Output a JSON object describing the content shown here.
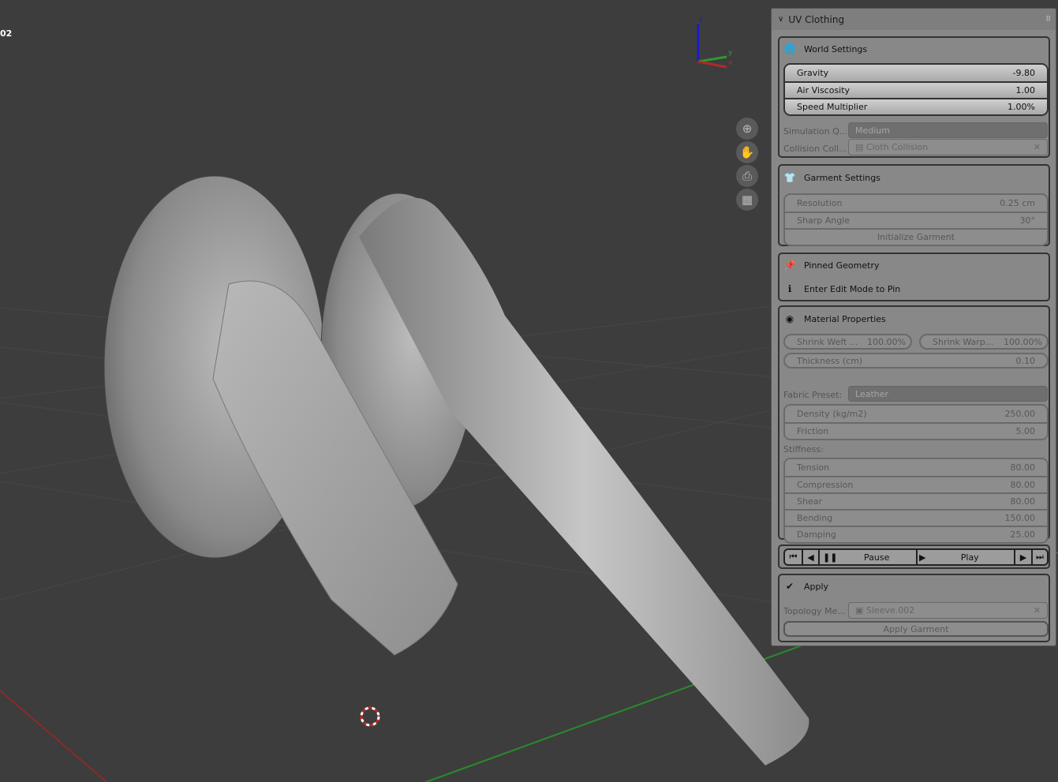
{
  "viewport": {
    "object_label": "02",
    "axes": {
      "x": "x",
      "y": "y",
      "z": "z"
    },
    "nav_icons": [
      "zoom-icon",
      "hand-pan-icon",
      "camera-icon",
      "grid-perspective-icon"
    ]
  },
  "panel": {
    "title": "UV Clothing",
    "world": {
      "title": "World Settings",
      "fields": [
        {
          "label": "Gravity",
          "value": "-9.80"
        },
        {
          "label": "Air Viscosity",
          "value": "1.00"
        },
        {
          "label": "Speed Multiplier",
          "value": "1.00%"
        }
      ],
      "sim_quality_label": "Simulation Q...",
      "sim_quality_value": "Medium",
      "collision_label": "Collision Coll...",
      "collision_value": "Cloth Collision"
    },
    "garment": {
      "title": "Garment Settings",
      "fields": [
        {
          "label": "Resolution",
          "value": "0.25 cm"
        },
        {
          "label": "Sharp Angle",
          "value": "30°"
        }
      ],
      "init_button": "Initialize Garment"
    },
    "pinned": {
      "title": "Pinned Geometry",
      "info": "Enter Edit Mode to Pin"
    },
    "material": {
      "title": "Material Properties",
      "shrink_weft_label": "Shrink Weft ...",
      "shrink_weft_value": "100.00%",
      "shrink_warp_label": "Shrink Warp...",
      "shrink_warp_value": "100.00%",
      "thickness_label": "Thickness (cm)",
      "thickness_value": "0.10",
      "preset_label": "Fabric Preset:",
      "preset_value": "Leather",
      "fields": [
        {
          "label": "Density (kg/m2)",
          "value": "250.00"
        },
        {
          "label": "Friction",
          "value": "5.00"
        }
      ],
      "stiffness_label": "Stiffness:",
      "stiffness": [
        {
          "label": "Tension",
          "value": "80.00"
        },
        {
          "label": "Compression",
          "value": "80.00"
        },
        {
          "label": "Shear",
          "value": "80.00"
        },
        {
          "label": "Bending",
          "value": "150.00"
        },
        {
          "label": "Damping",
          "value": "25.00"
        }
      ]
    },
    "transport": {
      "pause": "Pause",
      "play": "Play"
    },
    "apply": {
      "title": "Apply",
      "topology_label": "Topology Me...",
      "topology_value": "Sleeve.002",
      "apply_button": "Apply Garment"
    }
  },
  "colors": {
    "viewport_bg": "#3d3d3d",
    "x_axis": "#b02a2a",
    "y_axis": "#2f9a2f",
    "z_axis": "#1a1acc"
  }
}
